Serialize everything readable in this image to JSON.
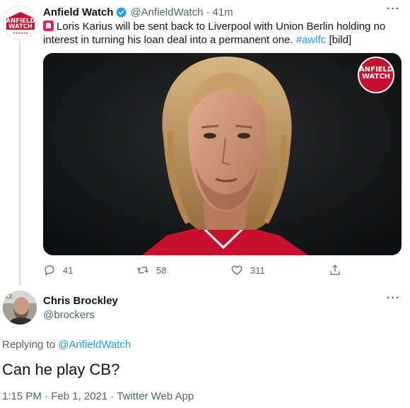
{
  "tweet": {
    "author_name": "Anfield Watch",
    "author_handle": "@AnfieldWatch",
    "separator": "·",
    "time": "41m",
    "more": "···",
    "text_main": "Loris Karius will be sent back to Liverpool with Union Berlin holding no interest in turning his loan deal into a permanent one.",
    "hashtag": "#awlfc",
    "text_tail": "[bild]",
    "logo_line1": "ANFIELD",
    "logo_line2": "WATCH",
    "watermark_line1": "ANFIELD",
    "watermark_line2": "WATCH",
    "replies": "41",
    "retweets": "58",
    "likes": "311"
  },
  "reply": {
    "author_name": "Chris Brockley",
    "author_handle": "@brockers",
    "more": "···",
    "replying_prefix": "Replying to",
    "replying_to": "@AnfieldWatch",
    "text": "Can he play CB?",
    "meta": "1:15 PM · Feb 1, 2021 · Twitter Web App"
  },
  "colors": {
    "brand_red": "#c8102e",
    "link_blue": "#1d9bf0",
    "muted_text": "#536471"
  }
}
